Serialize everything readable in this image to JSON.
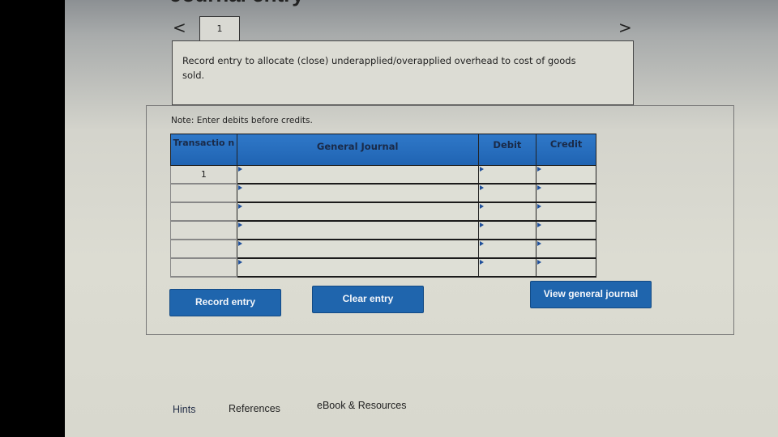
{
  "header": {
    "title_fragment": "Journal entry",
    "prev_icon": "chevron-left-icon",
    "next_icon": "chevron-right-icon",
    "prev_glyph": "<",
    "next_glyph": ">",
    "tabs": [
      {
        "label": "1",
        "active": true
      }
    ]
  },
  "prompt": {
    "text": "Record entry to allocate (close) underapplied/overapplied overhead to cost of goods sold."
  },
  "note": "Note: Enter debits before credits.",
  "journal": {
    "columns": [
      "Transaction",
      "General Journal",
      "Debit",
      "Credit"
    ],
    "column_display": {
      "transaction": "Transactio n"
    },
    "rows": [
      {
        "transaction": "1",
        "account": "",
        "debit": "",
        "credit": ""
      },
      {
        "transaction": "",
        "account": "",
        "debit": "",
        "credit": ""
      },
      {
        "transaction": "",
        "account": "",
        "debit": "",
        "credit": ""
      },
      {
        "transaction": "",
        "account": "",
        "debit": "",
        "credit": ""
      },
      {
        "transaction": "",
        "account": "",
        "debit": "",
        "credit": ""
      },
      {
        "transaction": "",
        "account": "",
        "debit": "",
        "credit": ""
      }
    ]
  },
  "buttons": {
    "record": "Record entry",
    "clear": "Clear entry",
    "view": "View general journal"
  },
  "footer": {
    "hints": "Hints",
    "references": "References",
    "ebook": "eBook & Resources"
  },
  "colors": {
    "header_blue": "#2f78c8",
    "button_blue": "#1f65ad"
  }
}
